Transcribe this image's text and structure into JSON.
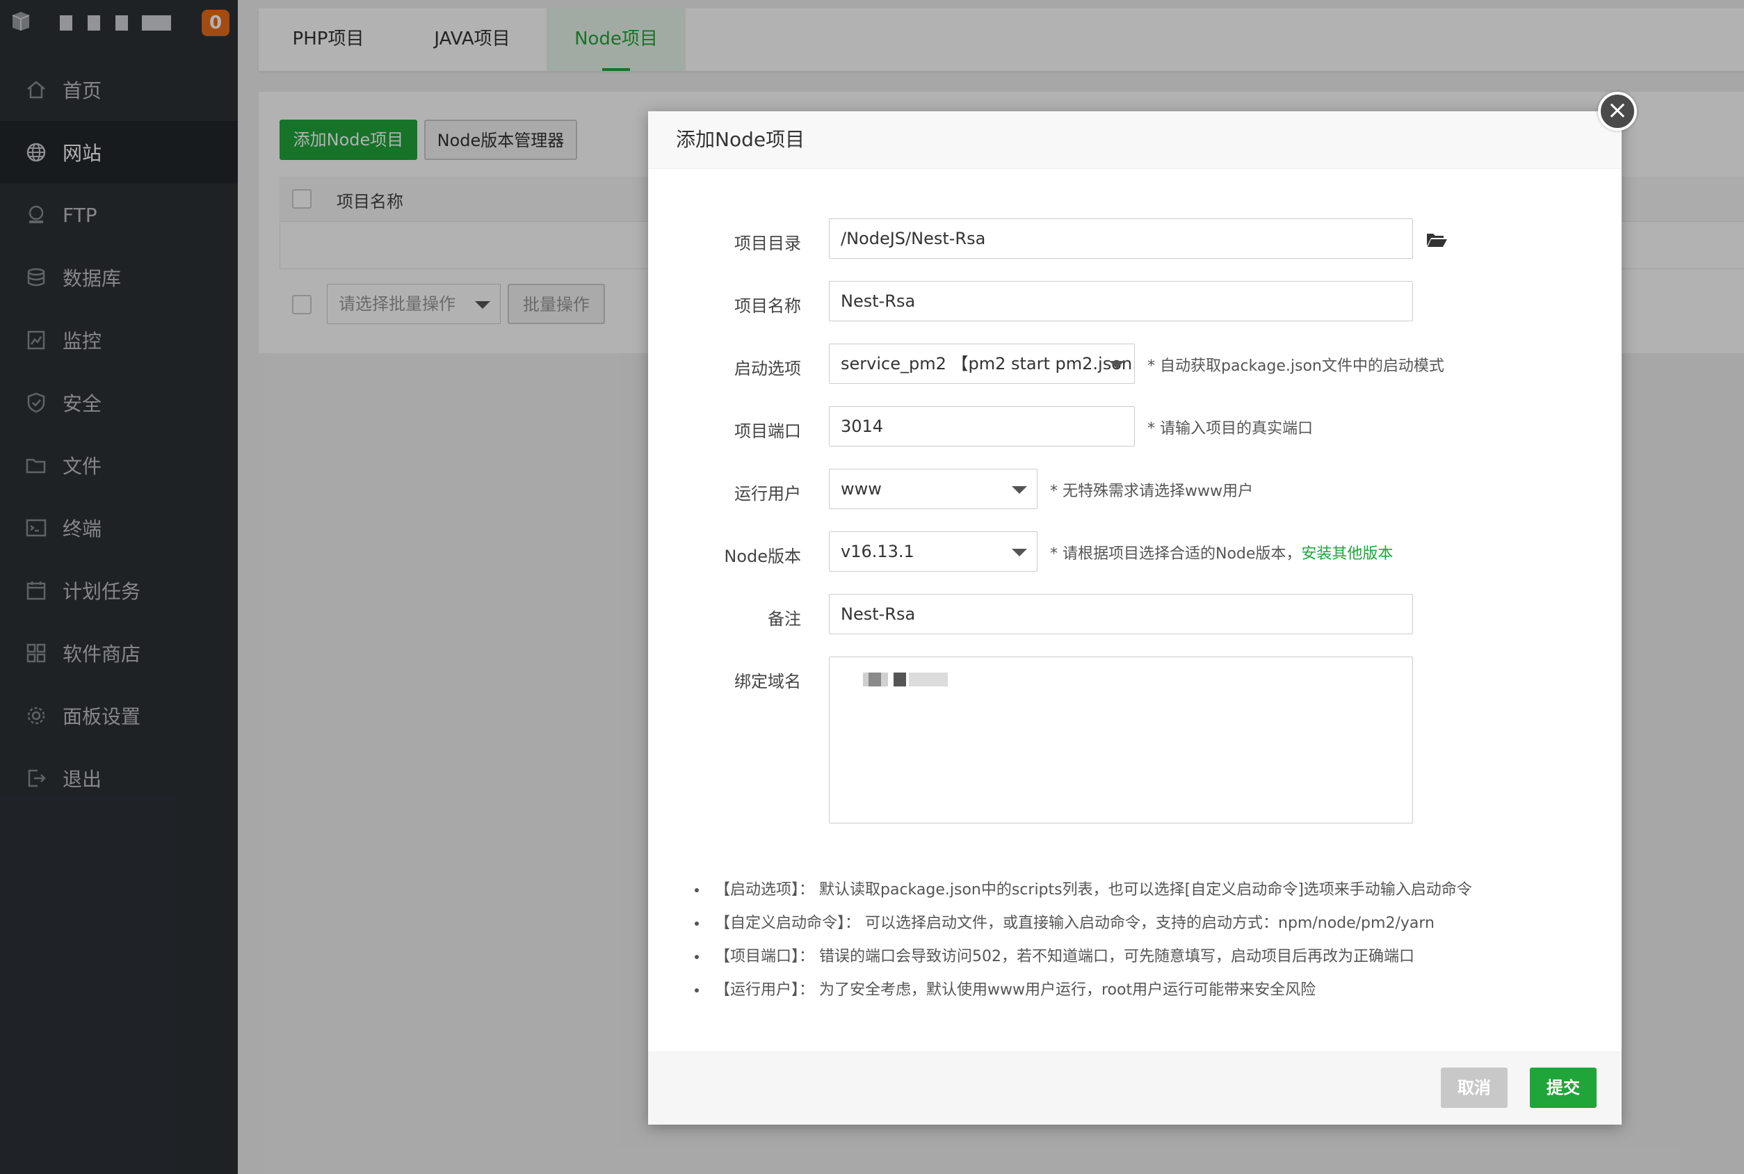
{
  "sidebar": {
    "badge": "0",
    "items": [
      {
        "label": "首页",
        "icon": "home-icon"
      },
      {
        "label": "网站",
        "icon": "globe-icon",
        "active": true
      },
      {
        "label": "FTP",
        "icon": "ftp-icon"
      },
      {
        "label": "数据库",
        "icon": "database-icon"
      },
      {
        "label": "监控",
        "icon": "monitor-icon"
      },
      {
        "label": "安全",
        "icon": "shield-icon"
      },
      {
        "label": "文件",
        "icon": "folder-icon"
      },
      {
        "label": "终端",
        "icon": "terminal-icon"
      },
      {
        "label": "计划任务",
        "icon": "calendar-icon"
      },
      {
        "label": "软件商店",
        "icon": "apps-icon"
      },
      {
        "label": "面板设置",
        "icon": "gear-icon"
      },
      {
        "label": "退出",
        "icon": "logout-icon"
      }
    ]
  },
  "tabs": [
    {
      "label": "PHP项目"
    },
    {
      "label": "JAVA项目"
    },
    {
      "label": "Node项目",
      "active": true
    }
  ],
  "toolbar": {
    "add_label": "添加Node项目",
    "version_manager_label": "Node版本管理器"
  },
  "table": {
    "col_name": "项目名称"
  },
  "batch": {
    "select_placeholder": "请选择批量操作",
    "apply_label": "批量操作"
  },
  "dialog": {
    "title": "添加Node项目",
    "fields": {
      "dir": {
        "label": "项目目录",
        "value": "/NodeJS/Nest-Rsa"
      },
      "name": {
        "label": "项目名称",
        "value": "Nest-Rsa"
      },
      "start": {
        "label": "启动选项",
        "value": "service_pm2 【pm2 start pm2.json…",
        "hint": "* 自动获取package.json文件中的启动模式"
      },
      "port": {
        "label": "项目端口",
        "value": "3014",
        "hint": "* 请输入项目的真实端口"
      },
      "user": {
        "label": "运行用户",
        "value": "www",
        "hint": "* 无特殊需求请选择www用户"
      },
      "node_version": {
        "label": "Node版本",
        "value": "v16.13.1",
        "hint": "* 请根据项目选择合适的Node版本，",
        "hint_link": "安装其他版本"
      },
      "remark": {
        "label": "备注",
        "value": "Nest-Rsa"
      },
      "domain": {
        "label": "绑定域名"
      }
    },
    "notes": [
      "【启动选项】： 默认读取package.json中的scripts列表，也可以选择[自定义启动命令]选项来手动输入启动命令",
      "【自定义启动命令】： 可以选择启动文件，或直接输入启动命令，支持的启动方式：npm/node/pm2/yarn",
      "【项目端口】： 错误的端口会导致访问502，若不知道端口，可先随意填写，启动项目后再改为正确端口",
      "【运行用户】： 为了安全考虑，默认使用www用户运行，root用户运行可能带来安全风险"
    ],
    "cancel_label": "取消",
    "submit_label": "提交"
  },
  "colors": {
    "accent": "#20a53a",
    "sidebar_bg": "#2d3136",
    "badge": "#e86c1c"
  }
}
